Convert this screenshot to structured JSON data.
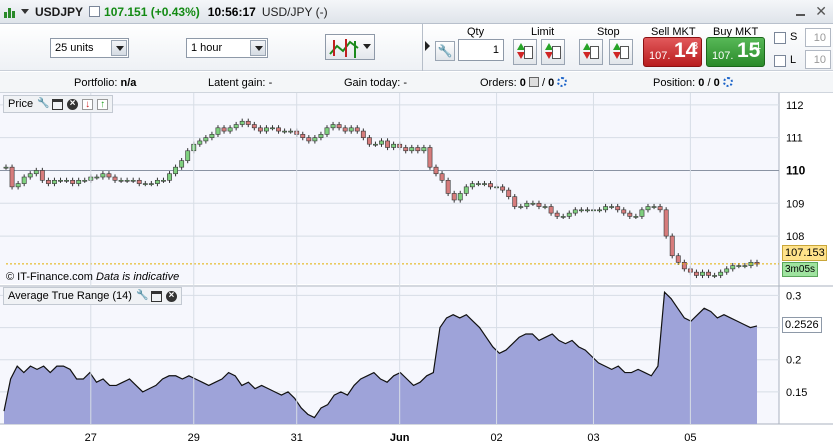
{
  "titlebar": {
    "symbol": "USDJPY",
    "price_change": "107.151 (+0.43%)",
    "time": "10:56:17",
    "subtitle": "USD/JPY (-)"
  },
  "toolbar": {
    "units": "25 units",
    "timeframe": "1 hour",
    "qty_label": "Qty",
    "qty_value": "1",
    "limit_label": "Limit",
    "stop_label": "Stop",
    "sell_label": "Sell MKT",
    "sell_prefix": "107.",
    "sell_big": "14",
    "sell_sup": "3",
    "buy_label": "Buy MKT",
    "buy_prefix": "107.",
    "buy_big": "15",
    "buy_sup": "1",
    "s_label": "S",
    "l_label": "L",
    "s_value": "10",
    "l_value": "10"
  },
  "infobar": {
    "portfolio_label": "Portfolio:",
    "portfolio_value": "n/a",
    "latent_label": "Latent gain:",
    "latent_value": "-",
    "today_label": "Gain today:",
    "today_value": "-",
    "orders_label": "Orders:",
    "orders_a": "0",
    "orders_b": "0",
    "position_label": "Position:",
    "position_a": "0",
    "position_b": "0",
    "sep": "/"
  },
  "price_panel": {
    "title": "Price",
    "copyright": "© IT-Finance.com",
    "indicative": "Data is indicative",
    "last_price": "107.153",
    "countdown": "3m05s"
  },
  "atr_panel": {
    "title": "Average True Range (14)",
    "current": "0.2526"
  },
  "colors": {
    "bull": "#7fd07f",
    "bear": "#d67c7c",
    "atr_fill": "#9ea3d9",
    "grid": "#d7dde6"
  },
  "chart_data": [
    {
      "type": "candlestick",
      "title": "Price",
      "ylim": [
        106.6,
        112.3
      ],
      "yticks": [
        108,
        109,
        110,
        111,
        112
      ],
      "yticks_bold": [
        110
      ],
      "x_tick_labels": [
        "27",
        "29",
        "31",
        "Jun",
        "02",
        "03",
        "05"
      ],
      "x_tick_index": [
        14,
        31,
        48,
        65,
        81,
        97,
        113
      ],
      "close": [
        110.1,
        109.5,
        109.6,
        109.8,
        109.9,
        110.0,
        109.7,
        109.6,
        109.7,
        109.7,
        109.7,
        109.6,
        109.7,
        109.7,
        109.8,
        109.8,
        109.9,
        109.8,
        109.7,
        109.7,
        109.7,
        109.7,
        109.6,
        109.6,
        109.6,
        109.7,
        109.7,
        109.9,
        110.1,
        110.3,
        110.6,
        110.8,
        110.9,
        111.0,
        111.1,
        111.3,
        111.2,
        111.3,
        111.4,
        111.5,
        111.4,
        111.3,
        111.2,
        111.3,
        111.3,
        111.2,
        111.2,
        111.2,
        111.1,
        111.0,
        110.9,
        111.0,
        111.1,
        111.3,
        111.4,
        111.3,
        111.2,
        111.3,
        111.2,
        111.0,
        110.8,
        110.8,
        110.9,
        110.7,
        110.8,
        110.7,
        110.6,
        110.7,
        110.6,
        110.7,
        110.1,
        109.9,
        109.7,
        109.3,
        109.1,
        109.3,
        109.5,
        109.6,
        109.6,
        109.6,
        109.5,
        109.5,
        109.4,
        109.2,
        108.9,
        108.9,
        109.0,
        109.0,
        108.9,
        108.9,
        108.7,
        108.6,
        108.6,
        108.7,
        108.8,
        108.8,
        108.8,
        108.8,
        108.8,
        108.9,
        108.9,
        108.8,
        108.7,
        108.6,
        108.6,
        108.8,
        108.9,
        108.9,
        108.8,
        108.0,
        107.4,
        107.2,
        107.0,
        106.9,
        106.8,
        106.9,
        106.8,
        106.8,
        106.9,
        107.0,
        107.1,
        107.1,
        107.1,
        107.2,
        107.15
      ],
      "last": 107.153
    },
    {
      "type": "area",
      "title": "Average True Range (14)",
      "ylim": [
        0.1,
        0.31
      ],
      "yticks": [
        0.15,
        0.2,
        0.25,
        0.3
      ],
      "values": [
        0.12,
        0.17,
        0.19,
        0.18,
        0.19,
        0.185,
        0.19,
        0.18,
        0.19,
        0.19,
        0.185,
        0.17,
        0.17,
        0.18,
        0.165,
        0.17,
        0.16,
        0.16,
        0.165,
        0.17,
        0.16,
        0.15,
        0.155,
        0.16,
        0.17,
        0.175,
        0.175,
        0.17,
        0.175,
        0.17,
        0.165,
        0.16,
        0.165,
        0.17,
        0.18,
        0.175,
        0.16,
        0.165,
        0.155,
        0.16,
        0.155,
        0.15,
        0.145,
        0.15,
        0.14,
        0.125,
        0.115,
        0.11,
        0.125,
        0.13,
        0.145,
        0.15,
        0.145,
        0.16,
        0.17,
        0.175,
        0.18,
        0.17,
        0.165,
        0.175,
        0.18,
        0.17,
        0.16,
        0.165,
        0.175,
        0.18,
        0.25,
        0.265,
        0.27,
        0.265,
        0.27,
        0.26,
        0.25,
        0.235,
        0.22,
        0.21,
        0.215,
        0.225,
        0.235,
        0.24,
        0.24,
        0.23,
        0.235,
        0.24,
        0.23,
        0.225,
        0.23,
        0.22,
        0.215,
        0.205,
        0.195,
        0.19,
        0.185,
        0.19,
        0.18,
        0.18,
        0.185,
        0.18,
        0.175,
        0.19,
        0.305,
        0.295,
        0.28,
        0.265,
        0.26,
        0.27,
        0.28,
        0.275,
        0.265,
        0.27,
        0.265,
        0.26,
        0.255,
        0.25,
        0.2526
      ],
      "current": 0.2526
    }
  ]
}
